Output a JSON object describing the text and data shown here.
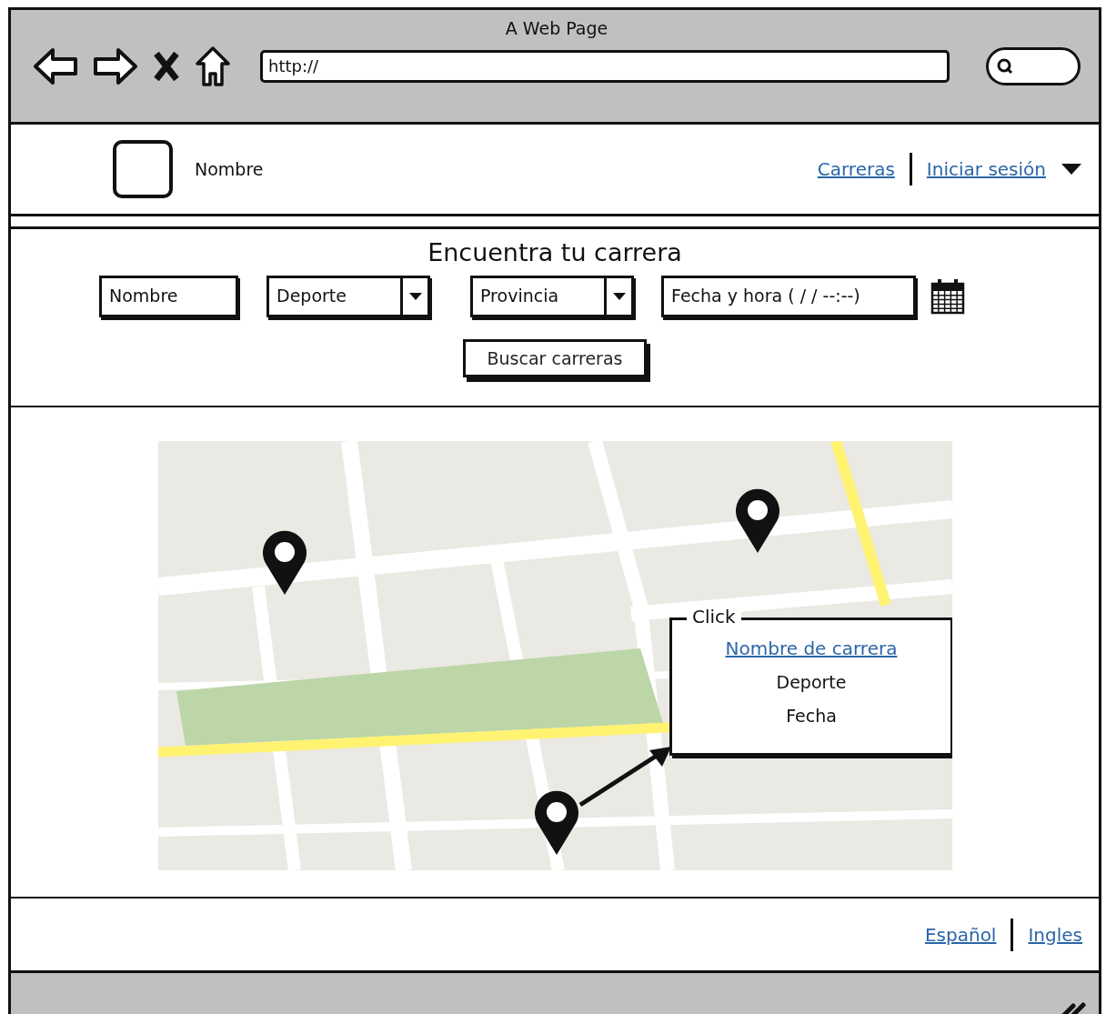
{
  "window": {
    "title": "A Web Page",
    "url": "http://"
  },
  "header": {
    "brand": "Nombre",
    "links": [
      {
        "label": "Carreras",
        "dropdown": false
      },
      {
        "label": "Iniciar sesión",
        "dropdown": true
      }
    ]
  },
  "search": {
    "title": "Encuentra tu carrera",
    "fields": [
      {
        "kind": "text",
        "value": "Nombre"
      },
      {
        "kind": "select",
        "value": "Deporte"
      },
      {
        "kind": "select",
        "value": "Provincia"
      },
      {
        "kind": "datetime",
        "value": "Fecha y hora ( /  /     --:--)"
      }
    ],
    "button": "Buscar carreras"
  },
  "map": {
    "kind": "picture",
    "popup": {
      "title": "Click",
      "link": "Nombre de carrera",
      "lines": [
        "Deporte",
        "Fecha"
      ]
    }
  },
  "footer": {
    "languages": [
      "Español",
      "Ingles"
    ]
  }
}
